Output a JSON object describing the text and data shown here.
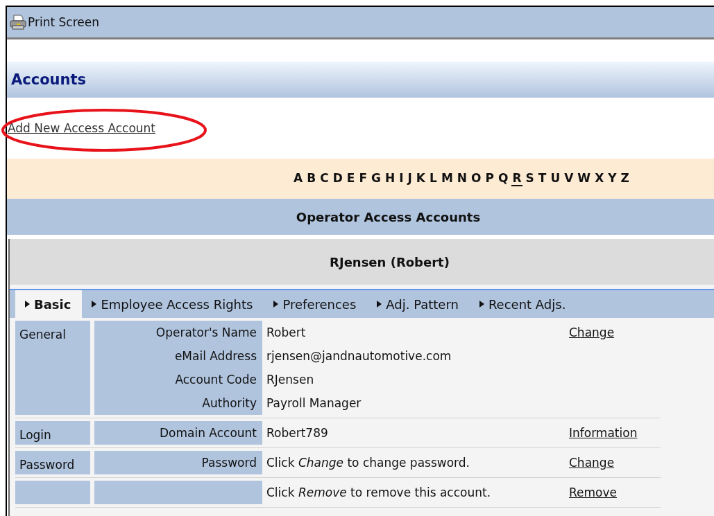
{
  "toolbar": {
    "print_label": "Print Screen"
  },
  "page_title": "Accounts",
  "add_link": {
    "label": "Add New Access Account",
    "highlighted": true
  },
  "letters": [
    {
      "letter": "A",
      "selected": false
    },
    {
      "letter": "B",
      "selected": false
    },
    {
      "letter": "C",
      "selected": false
    },
    {
      "letter": "D",
      "selected": false
    },
    {
      "letter": "E",
      "selected": false
    },
    {
      "letter": "F",
      "selected": false
    },
    {
      "letter": "G",
      "selected": false
    },
    {
      "letter": "H",
      "selected": false
    },
    {
      "letter": "I",
      "selected": false
    },
    {
      "letter": "J",
      "selected": false
    },
    {
      "letter": "K",
      "selected": false
    },
    {
      "letter": "L",
      "selected": false
    },
    {
      "letter": "M",
      "selected": false
    },
    {
      "letter": "N",
      "selected": false
    },
    {
      "letter": "O",
      "selected": false
    },
    {
      "letter": "P",
      "selected": false
    },
    {
      "letter": "Q",
      "selected": false
    },
    {
      "letter": "R",
      "selected": true
    },
    {
      "letter": "S",
      "selected": false
    },
    {
      "letter": "T",
      "selected": false
    },
    {
      "letter": "U",
      "selected": false
    },
    {
      "letter": "V",
      "selected": false
    },
    {
      "letter": "W",
      "selected": false
    },
    {
      "letter": "X",
      "selected": false
    },
    {
      "letter": "Y",
      "selected": false
    },
    {
      "letter": "Z",
      "selected": false
    }
  ],
  "section_title": "Operator Access Accounts",
  "account_title": "RJensen (Robert)",
  "tabs": [
    {
      "label": "Basic",
      "selected": true
    },
    {
      "label": "Employee Access Rights",
      "selected": false
    },
    {
      "label": "Preferences",
      "selected": false
    },
    {
      "label": "Adj. Pattern",
      "selected": false
    },
    {
      "label": "Recent Adjs.",
      "selected": false
    }
  ],
  "sections": [
    {
      "label": "General",
      "fields": [
        {
          "label": "Operator's Name",
          "value": "Robert",
          "action": "Change"
        },
        {
          "label": "eMail Address",
          "value": "rjensen@jandnautomotive.com"
        },
        {
          "label": "Account Code",
          "value": "RJensen"
        },
        {
          "label": "Authority",
          "value": "Payroll Manager"
        }
      ]
    },
    {
      "label": "Login",
      "fields": [
        {
          "label": "Domain Account",
          "value": "Robert789",
          "action": "Information"
        }
      ]
    },
    {
      "label": "Password",
      "fields": [
        {
          "label": "Password",
          "value": "Click *Change* to change password.",
          "action": "Change"
        }
      ]
    },
    {
      "fields": [
        {
          "value": "Click *Remove* to remove this account.",
          "action": "Remove"
        }
      ]
    }
  ]
}
